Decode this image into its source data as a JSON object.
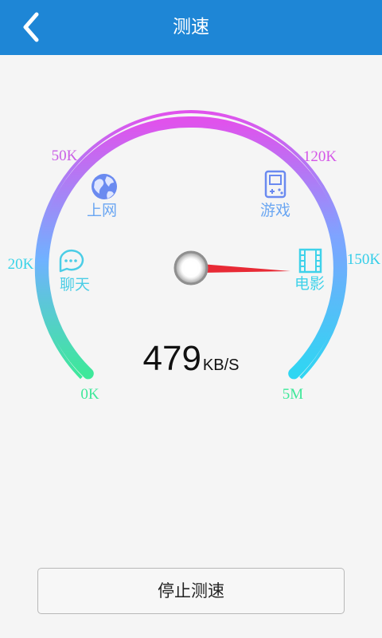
{
  "header": {
    "title": "测速",
    "back_icon": "chevron-left-icon"
  },
  "gauge": {
    "ticks": [
      "0K",
      "20K",
      "50K",
      "120K",
      "150K",
      "5M"
    ],
    "categories": [
      {
        "label": "上网",
        "icon": "globe-icon"
      },
      {
        "label": "游戏",
        "icon": "gamepad-icon"
      },
      {
        "label": "聊天",
        "icon": "chat-bubble-icon"
      },
      {
        "label": "电影",
        "icon": "film-icon"
      }
    ],
    "colors": {
      "start": "#3ee89a",
      "mid": "#9a7dff",
      "top": "#e052ec",
      "end": "#2fd6f2",
      "needle": "#e82a35"
    }
  },
  "speed": {
    "value": "479",
    "unit": "KB/S"
  },
  "actions": {
    "stop_label": "停止测速"
  },
  "colors": {
    "header_bg": "#1e86d6",
    "page_bg": "#f5f5f5"
  }
}
